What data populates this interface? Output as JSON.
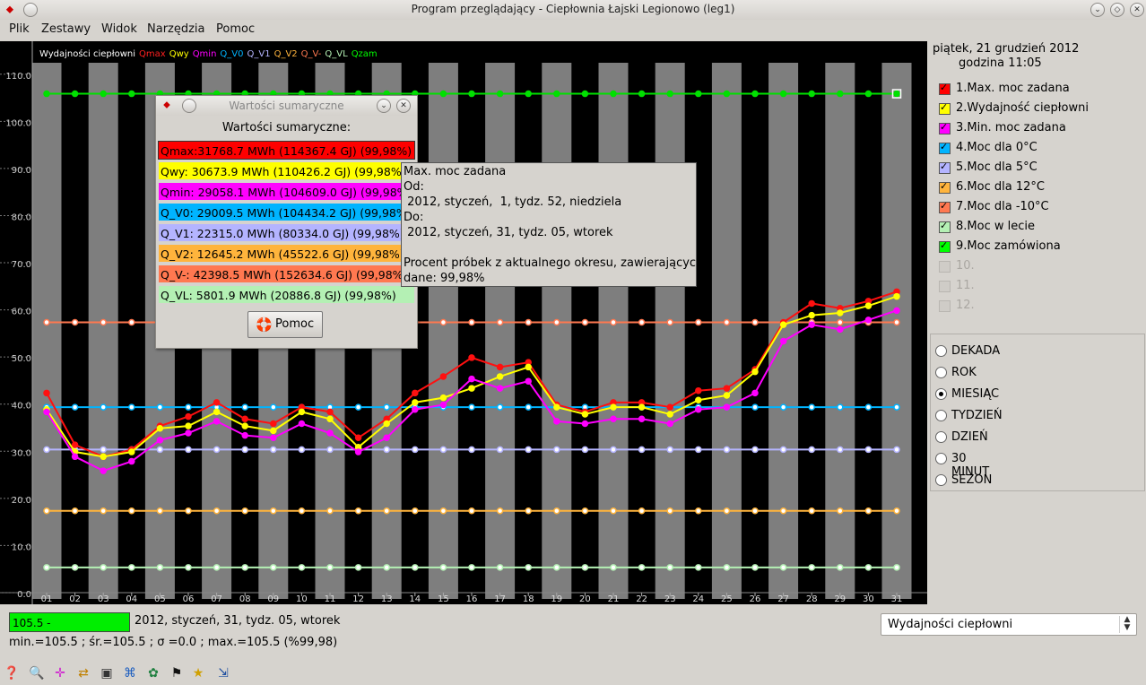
{
  "window": {
    "title": "Program przeglądający - Ciepłownia Łajski Legionowo (leg1)"
  },
  "menu": [
    "Plik",
    "Zestawy",
    "Widok",
    "Narzędzia",
    "Pomoc"
  ],
  "plot": {
    "legend": [
      {
        "label": "Wydajności ciepłowni",
        "color": "#ffffff"
      },
      {
        "label": "Qmax",
        "color": "#ff2020"
      },
      {
        "label": "Qwy",
        "color": "#ffff00"
      },
      {
        "label": "Qmin",
        "color": "#ff00ff"
      },
      {
        "label": "Q_V0",
        "color": "#00b4ff"
      },
      {
        "label": "Q_V1",
        "color": "#b4b4ff"
      },
      {
        "label": "Q_V2",
        "color": "#ffb43c"
      },
      {
        "label": "Q_V-",
        "color": "#ff7850"
      },
      {
        "label": "Q_VL",
        "color": "#b4f0b4"
      },
      {
        "label": "Qzam",
        "color": "#00ff00"
      }
    ]
  },
  "chart_data": {
    "type": "line",
    "x": [
      "01",
      "02",
      "03",
      "04",
      "05",
      "06",
      "07",
      "08",
      "09",
      "10",
      "11",
      "12",
      "13",
      "14",
      "15",
      "16",
      "17",
      "18",
      "19",
      "20",
      "21",
      "22",
      "23",
      "24",
      "25",
      "26",
      "27",
      "28",
      "29",
      "30",
      "31"
    ],
    "yticks": [
      "0.0",
      "10.0",
      "20.0",
      "30.0",
      "40.0",
      "50.0",
      "60.0",
      "70.0",
      "80.0",
      "90.0",
      "100.0",
      "110.0"
    ],
    "ylim": [
      0,
      113
    ],
    "series": [
      {
        "name": "Qzam",
        "color": "#00e000",
        "values": [
          107,
          107,
          107,
          107,
          107,
          107,
          107,
          107,
          107,
          107,
          107,
          107,
          107,
          107,
          107,
          107,
          107,
          107,
          107,
          107,
          107,
          107,
          107,
          107,
          107,
          107,
          107,
          107,
          107,
          107,
          107
        ]
      },
      {
        "name": "Q_V-",
        "color": "#ff7850",
        "values": [
          58.5,
          58.5,
          58.5,
          58.5,
          58.5,
          58.5,
          58.5,
          58.5,
          58.5,
          58.5,
          58.5,
          58.5,
          58.5,
          58.5,
          58.5,
          58.5,
          58.5,
          58.5,
          58.5,
          58.5,
          58.5,
          58.5,
          58.5,
          58.5,
          58.5,
          58.5,
          58.5,
          58.5,
          58.5,
          58.5,
          58.5
        ]
      },
      {
        "name": "Q_V0",
        "color": "#00b4ff",
        "values": [
          40.5,
          40.5,
          40.5,
          40.5,
          40.5,
          40.5,
          40.5,
          40.5,
          40.5,
          40.5,
          40.5,
          40.5,
          40.5,
          40.5,
          40.5,
          40.5,
          40.5,
          40.5,
          40.5,
          40.5,
          40.5,
          40.5,
          40.5,
          40.5,
          40.5,
          40.5,
          40.5,
          40.5,
          40.5,
          40.5,
          40.5
        ]
      },
      {
        "name": "Q_V1",
        "color": "#b4b4ff",
        "values": [
          31.5,
          31.5,
          31.5,
          31.5,
          31.5,
          31.5,
          31.5,
          31.5,
          31.5,
          31.5,
          31.5,
          31.5,
          31.5,
          31.5,
          31.5,
          31.5,
          31.5,
          31.5,
          31.5,
          31.5,
          31.5,
          31.5,
          31.5,
          31.5,
          31.5,
          31.5,
          31.5,
          31.5,
          31.5,
          31.5,
          31.5
        ]
      },
      {
        "name": "Q_V2",
        "color": "#ffb43c",
        "values": [
          18.5,
          18.5,
          18.5,
          18.5,
          18.5,
          18.5,
          18.5,
          18.5,
          18.5,
          18.5,
          18.5,
          18.5,
          18.5,
          18.5,
          18.5,
          18.5,
          18.5,
          18.5,
          18.5,
          18.5,
          18.5,
          18.5,
          18.5,
          18.5,
          18.5,
          18.5,
          18.5,
          18.5,
          18.5,
          18.5,
          18.5
        ]
      },
      {
        "name": "Q_VL",
        "color": "#b4f0b4",
        "values": [
          6.5,
          6.5,
          6.5,
          6.5,
          6.5,
          6.5,
          6.5,
          6.5,
          6.5,
          6.5,
          6.5,
          6.5,
          6.5,
          6.5,
          6.5,
          6.5,
          6.5,
          6.5,
          6.5,
          6.5,
          6.5,
          6.5,
          6.5,
          6.5,
          6.5,
          6.5,
          6.5,
          6.5,
          6.5,
          6.5,
          6.5
        ]
      },
      {
        "name": "Qmax",
        "color": "#ff1010",
        "values": [
          43.5,
          32.5,
          30,
          31.5,
          36.5,
          38.5,
          41.5,
          38,
          37,
          40.5,
          39.5,
          34,
          38,
          43.5,
          47,
          51,
          49,
          50,
          41,
          39.5,
          41.5,
          41.5,
          40.5,
          44,
          44.5,
          48.5,
          58.5,
          62.5,
          61.5,
          63,
          65
        ]
      },
      {
        "name": "Qwy",
        "color": "#ffff00",
        "values": [
          40,
          31,
          30,
          31,
          36,
          36.5,
          39.5,
          36.5,
          35.5,
          39.5,
          38,
          32,
          37,
          41.5,
          42.5,
          44.5,
          47,
          49,
          40.5,
          39,
          40.5,
          40.5,
          39,
          42,
          43,
          48,
          58,
          60,
          60.5,
          62,
          64
        ]
      },
      {
        "name": "Qmin",
        "color": "#ff00ff",
        "values": [
          39.5,
          30,
          27,
          29,
          33.5,
          35,
          37.5,
          34.5,
          34,
          37,
          35,
          31,
          34,
          40,
          41,
          46.5,
          44.5,
          46,
          37.5,
          37,
          38,
          38,
          37,
          40,
          40.5,
          43.5,
          54.5,
          58,
          57,
          59,
          61
        ]
      }
    ]
  },
  "right": {
    "date": "piątek, 21 grudzień 2012",
    "time": "godzina 11:05",
    "legend": [
      {
        "label": "1.Max. moc zadana",
        "color": "#ff0000",
        "checked": true,
        "enabled": true
      },
      {
        "label": "2.Wydajność ciepłowni",
        "color": "#ffff00",
        "checked": true,
        "enabled": true
      },
      {
        "label": "3.Min. moc zadana",
        "color": "#ff00ff",
        "checked": true,
        "enabled": true
      },
      {
        "label": "4.Moc dla 0°C",
        "color": "#00b4ff",
        "checked": true,
        "enabled": true
      },
      {
        "label": "5.Moc dla 5°C",
        "color": "#b4b4ff",
        "checked": true,
        "enabled": true
      },
      {
        "label": "6.Moc dla 12°C",
        "color": "#ffb43c",
        "checked": true,
        "enabled": true
      },
      {
        "label": "7.Moc dla -10°C",
        "color": "#ff7850",
        "checked": true,
        "enabled": true
      },
      {
        "label": "8.Moc w lecie",
        "color": "#b4f0b4",
        "checked": true,
        "enabled": true
      },
      {
        "label": "9.Moc zamówiona",
        "color": "#00ff00",
        "checked": true,
        "enabled": true
      },
      {
        "label": "10.",
        "color": "#cfccc7",
        "checked": false,
        "enabled": false
      },
      {
        "label": "11.",
        "color": "#cfccc7",
        "checked": false,
        "enabled": false
      },
      {
        "label": "12.",
        "color": "#cfccc7",
        "checked": false,
        "enabled": false
      }
    ],
    "periods": [
      {
        "label": "DEKADA",
        "selected": false
      },
      {
        "label": "ROK",
        "selected": false
      },
      {
        "label": "MIESIĄC",
        "selected": true
      },
      {
        "label": "TYDZIEŃ",
        "selected": false
      },
      {
        "label": "DZIEŃ",
        "selected": false
      },
      {
        "label": "30 MINUT",
        "selected": false
      },
      {
        "label": "SEZON",
        "selected": false
      }
    ]
  },
  "status": {
    "value": "105.5 -",
    "date": "2012, styczeń, 31, tydz. 05, wtorek",
    "stats": "min.=105.5 ; śr.=105.5 ; σ =0.0 ; max.=105.5  (%99,98)"
  },
  "combo": {
    "value": "Wydajności ciepłowni"
  },
  "dialog": {
    "title": "Wartości sumaryczne",
    "heading": "Wartości sumaryczne:",
    "rows": [
      {
        "text": "Qmax:31768.7 MWh (114367.4 GJ) (99,98%)",
        "color": "#ff0000"
      },
      {
        "text": "Qwy:   30673.9 MWh (110426.2 GJ) (99,98%)",
        "color": "#ffff00"
      },
      {
        "text": "Qmin:  29058.1 MWh (104609.0 GJ) (99,98%)",
        "color": "#ff00ff"
      },
      {
        "text": "Q_V0:  29009.5 MWh (104434.2 GJ) (99,98%)",
        "color": "#00b4ff"
      },
      {
        "text": "Q_V1:    22315.0 MWh (80334.0 GJ) (99,98%)",
        "color": "#b4b4ff"
      },
      {
        "text": "Q_V2:    12645.2 MWh (45522.6 GJ) (99,98%)",
        "color": "#ffb43c"
      },
      {
        "text": "Q_V-:   42398.5 MWh (152634.6 GJ) (99,98%)",
        "color": "#ff7850"
      },
      {
        "text": "Q_VL:     5801.9 MWh (20886.8 GJ) (99,98%)",
        "color": "#b4f0b4"
      }
    ],
    "help_label": "Pomoc"
  },
  "tooltip": [
    "Max. moc zadana",
    "Od:",
    " 2012, styczeń,  1, tydz. 52, niedziela",
    "Do:",
    " 2012, styczeń, 31, tydz. 05, wtorek",
    "",
    "Procent próbek z aktualnego okresu, zawierających",
    "dane: 99,98%"
  ],
  "toolbar_icons": [
    "help-icon",
    "zoom-icon",
    "crosshair-icon",
    "swap-icon",
    "window-icon",
    "filter-icon",
    "palette-icon",
    "flag-icon",
    "star-icon",
    "export-icon"
  ]
}
